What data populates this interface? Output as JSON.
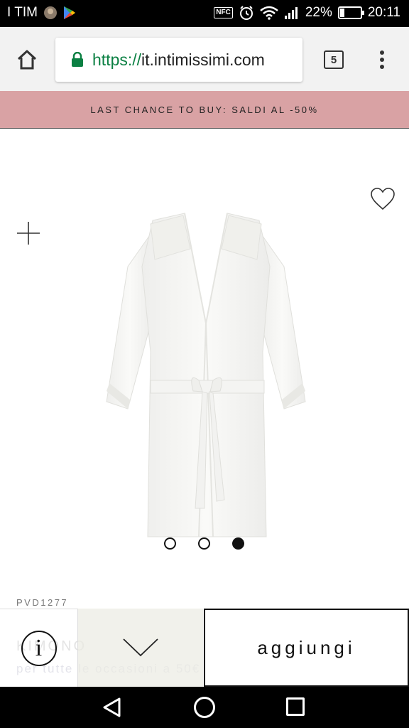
{
  "status_bar": {
    "carrier": "I TIM",
    "nfc_label": "NFC",
    "battery": "22%",
    "battery_level": 0.22,
    "time": "20:11"
  },
  "browser": {
    "url_scheme": "https://",
    "url_host": "it.intimissimi.com",
    "tab_count": "5"
  },
  "promo": {
    "text": "LAST CHANCE TO BUY: SALDI AL -50%"
  },
  "product": {
    "sku": "PVD1277",
    "faded_title": "KIMONO",
    "faded_subtitle": "per tutte le occasioni a 50€",
    "image_count": 3,
    "active_image": 3
  },
  "actions": {
    "add_label": "aggiungi",
    "info_glyph": "i"
  },
  "colors": {
    "promo_bg": "#d9a2a4",
    "url_scheme": "#0b8043"
  }
}
